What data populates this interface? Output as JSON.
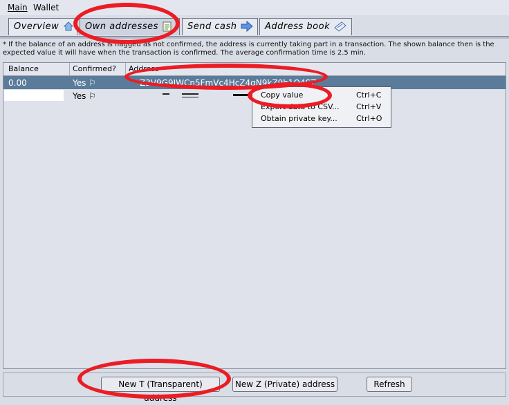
{
  "menu": {
    "main": "Main",
    "wallet": "Wallet"
  },
  "tabs": [
    {
      "label": "Overview"
    },
    {
      "label": "Own addresses"
    },
    {
      "label": "Send cash"
    },
    {
      "label": "Address book"
    }
  ],
  "note": "* If the balance of an address is flagged as not confirmed, the address is currently taking part in a transaction. The shown balance then is the expected value it will have when the transaction is confirmed. The average confirmation time is 2.5 min.",
  "table": {
    "headers": {
      "balance": "Balance",
      "confirmed": "Confirmed?",
      "address": "Address"
    },
    "rows": [
      {
        "balance": "0.00",
        "confirmed": "Yes ⚐",
        "address": "Z3V9G9JWCn5FmVc4HcZ4gN9kZ9h1Q4SZ"
      },
      {
        "balance": "",
        "confirmed": "Yes ⚐",
        "address": ""
      }
    ]
  },
  "context_menu": [
    {
      "label": "Copy value",
      "shortcut": "Ctrl+C"
    },
    {
      "label": "Export data to CSV...",
      "shortcut": "Ctrl+V"
    },
    {
      "label": "Obtain private key...",
      "shortcut": "Ctrl+O"
    }
  ],
  "buttons": {
    "new_t": "New T (Transparent) address",
    "new_z": "New Z (Private) address",
    "refresh": "Refresh"
  },
  "colors": {
    "annotation": "#ec1c24",
    "selected_row": "#5a7b99"
  }
}
